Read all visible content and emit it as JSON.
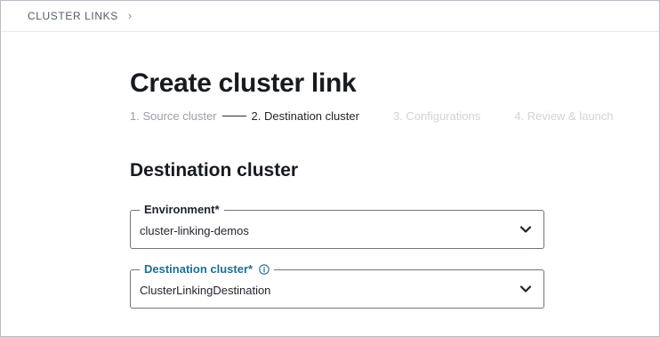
{
  "breadcrumb": {
    "label": "CLUSTER LINKS",
    "separator": "›"
  },
  "page": {
    "title": "Create cluster link"
  },
  "steps": [
    {
      "label": "1. Source cluster",
      "state": "completed"
    },
    {
      "label": "2. Destination cluster",
      "state": "active"
    },
    {
      "label": "3. Configurations",
      "state": "upcoming"
    },
    {
      "label": "4. Review & launch",
      "state": "upcoming"
    }
  ],
  "section": {
    "title": "Destination cluster"
  },
  "fields": {
    "environment": {
      "label": "Environment*",
      "value": "cluster-linking-demos",
      "icon": "chevron-down-icon"
    },
    "destination_cluster": {
      "label": "Destination cluster*",
      "value": "ClusterLinkingDestination",
      "icon": "chevron-down-icon",
      "info_icon": "info-icon"
    }
  },
  "colors": {
    "accent_label": "#1f6f91",
    "text_primary": "#161a21",
    "step_completed": "#9aa0a8",
    "step_upcoming": "#d0d3d8",
    "border": "#6f747d"
  }
}
